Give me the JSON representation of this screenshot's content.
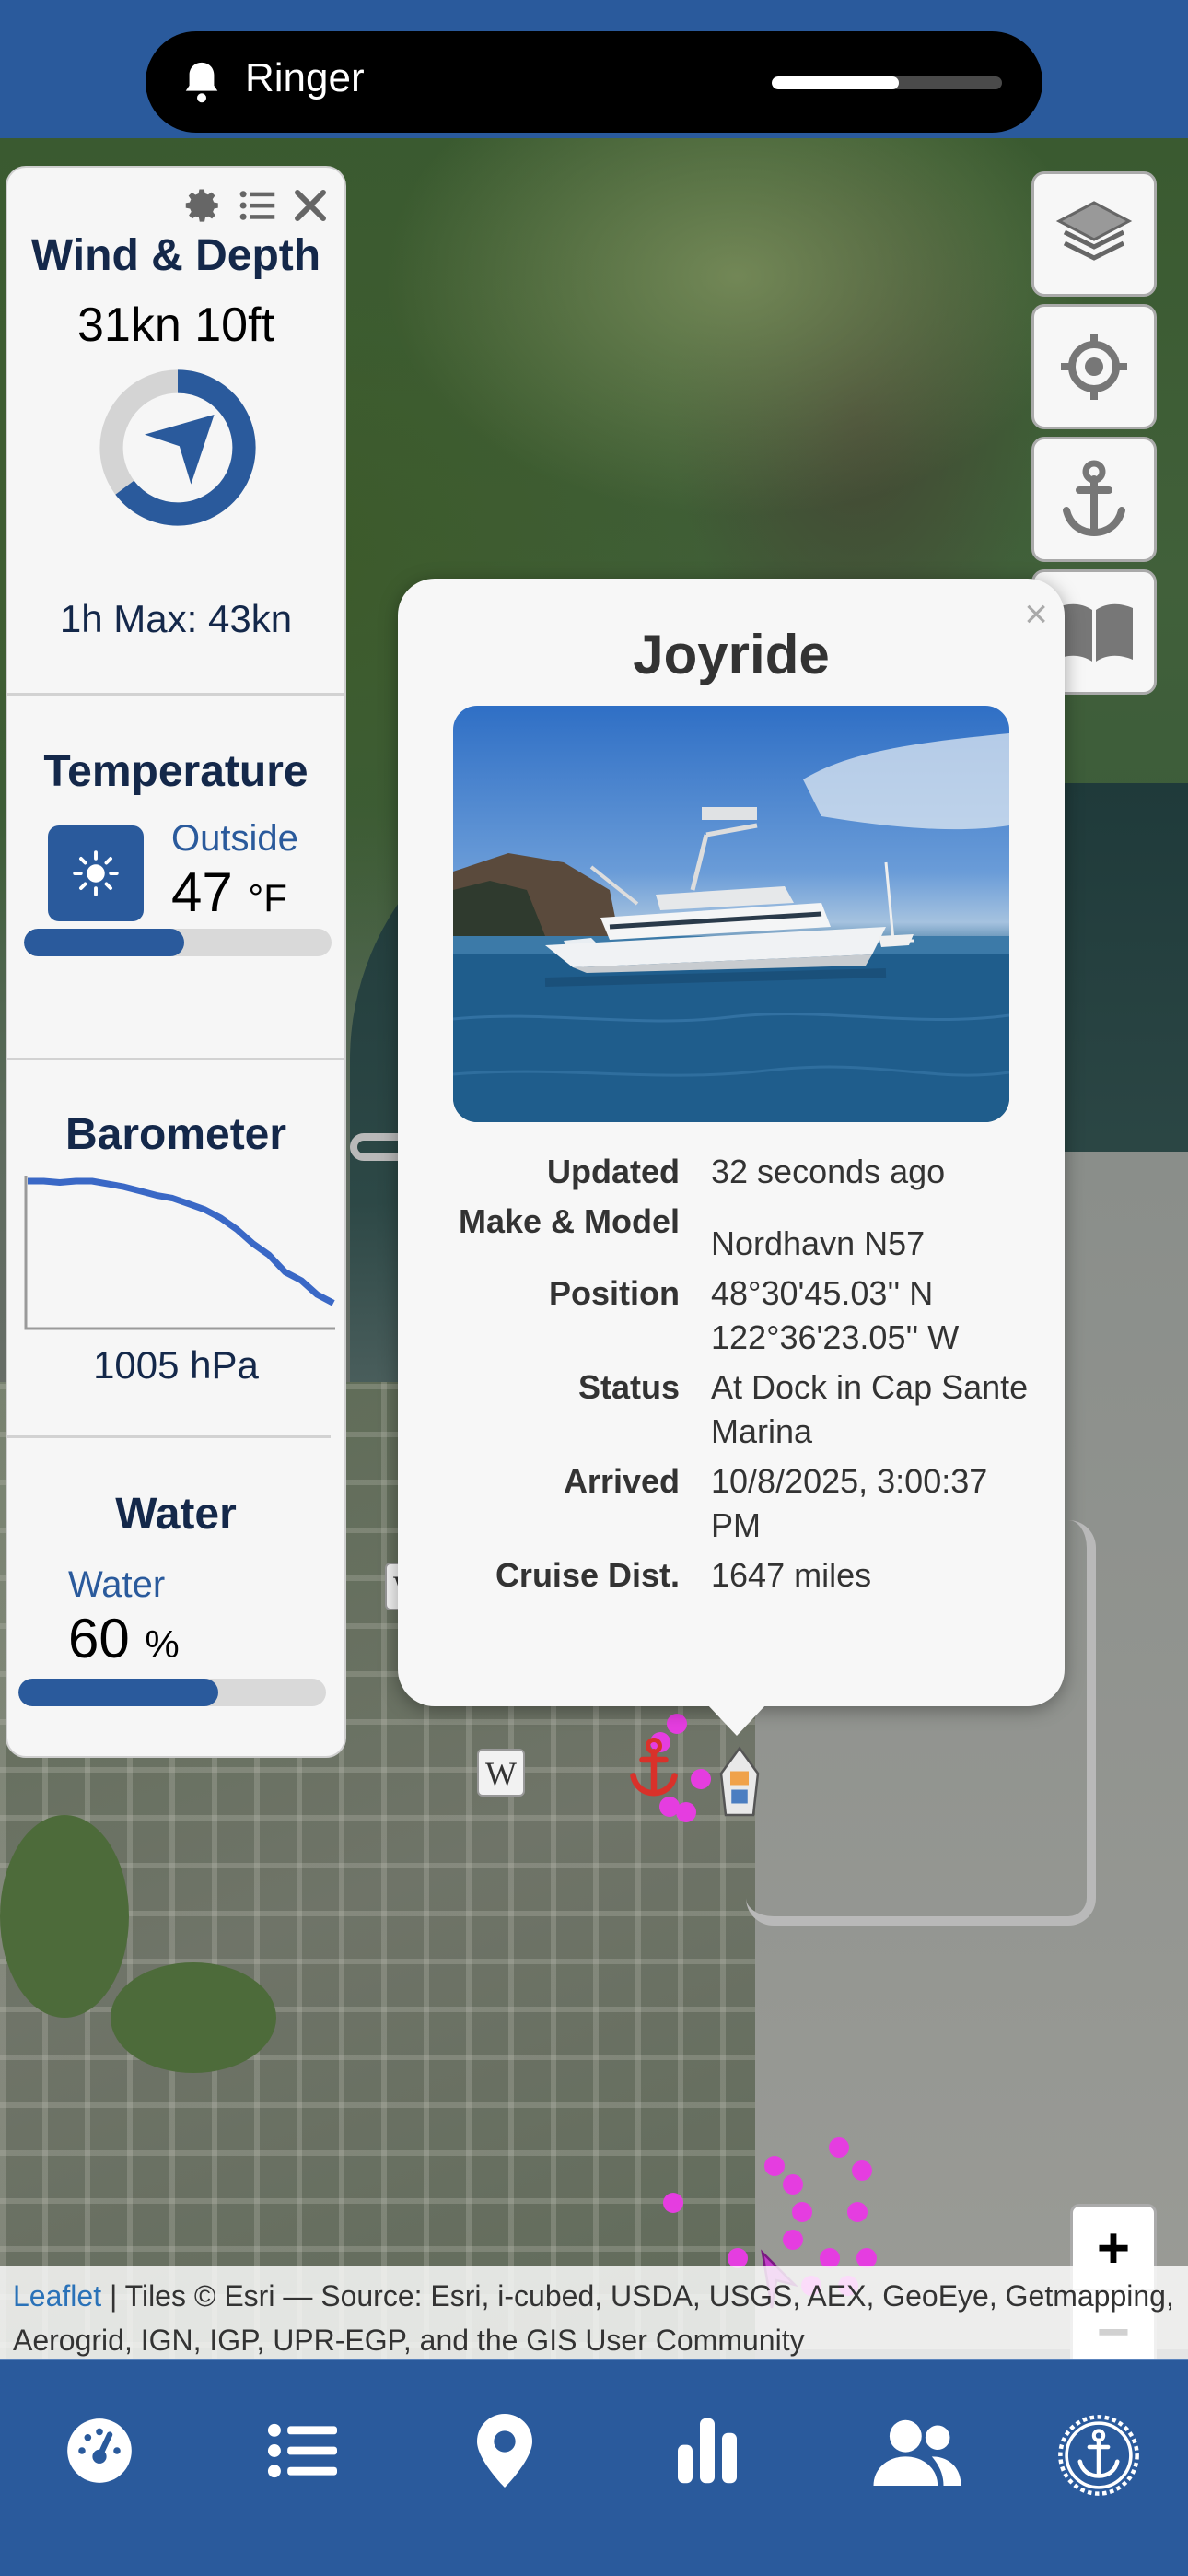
{
  "status_bar": {
    "ringer_label": "Ringer",
    "volume_level": 0.55
  },
  "widgets": {
    "wind_depth": {
      "title": "Wind & Depth",
      "values": "31kn 10ft",
      "max": "1h Max: 43kn"
    },
    "temperature": {
      "title": "Temperature",
      "label": "Outside",
      "value": "47",
      "unit": "°F",
      "level": 0.52
    },
    "barometer": {
      "title": "Barometer",
      "value": "1005 hPa",
      "trend": [
        1,
        1,
        0.99,
        1,
        1,
        0.98,
        0.96,
        0.93,
        0.9,
        0.88,
        0.84,
        0.8,
        0.74,
        0.66,
        0.56,
        0.48,
        0.36,
        0.3,
        0.2,
        0.14
      ]
    },
    "water": {
      "title": "Water",
      "label": "Water",
      "value": "60",
      "unit": "%",
      "level": 0.65
    }
  },
  "popup": {
    "close_label": "×",
    "title": "Joyride",
    "details": [
      {
        "label": "Updated",
        "value": "32 seconds ago"
      },
      {
        "label": "Make & Model",
        "value": "Nordhavn N57"
      },
      {
        "label": "Position",
        "value": "48°30'45.03'' N 122°36'23.05'' W"
      },
      {
        "label": "Status",
        "value": "At Dock in Cap Sante Marina"
      },
      {
        "label": "Arrived",
        "value": "10/8/2025, 3:00:37 PM"
      },
      {
        "label": "Cruise Dist.",
        "value": "1647 miles"
      }
    ]
  },
  "map": {
    "zoom_in_label": "+",
    "zoom_out_label": "−",
    "wiki_label": "W",
    "attribution": {
      "leaflet": "Leaflet",
      "text": " | Tiles © Esri — Source: Esri, i-cubed, USDA, USGS, AEX, GeoEye, Getmapping, Aerogrid, IGN, IGP, UPR-EGP, and the GIS User Community"
    },
    "buttons": [
      "layers-icon",
      "locate-icon",
      "anchor-icon",
      "book-icon"
    ]
  },
  "tabbar": {
    "tabs": [
      "dashboard-icon",
      "list-icon",
      "map-pin-icon",
      "chart-icon",
      "people-icon",
      "anchor-icon"
    ]
  },
  "colors": {
    "brand": "#2a5a9c",
    "panel": "#f6f6f6",
    "track_marker": "#e53de0",
    "anchor": "#d9312a"
  }
}
